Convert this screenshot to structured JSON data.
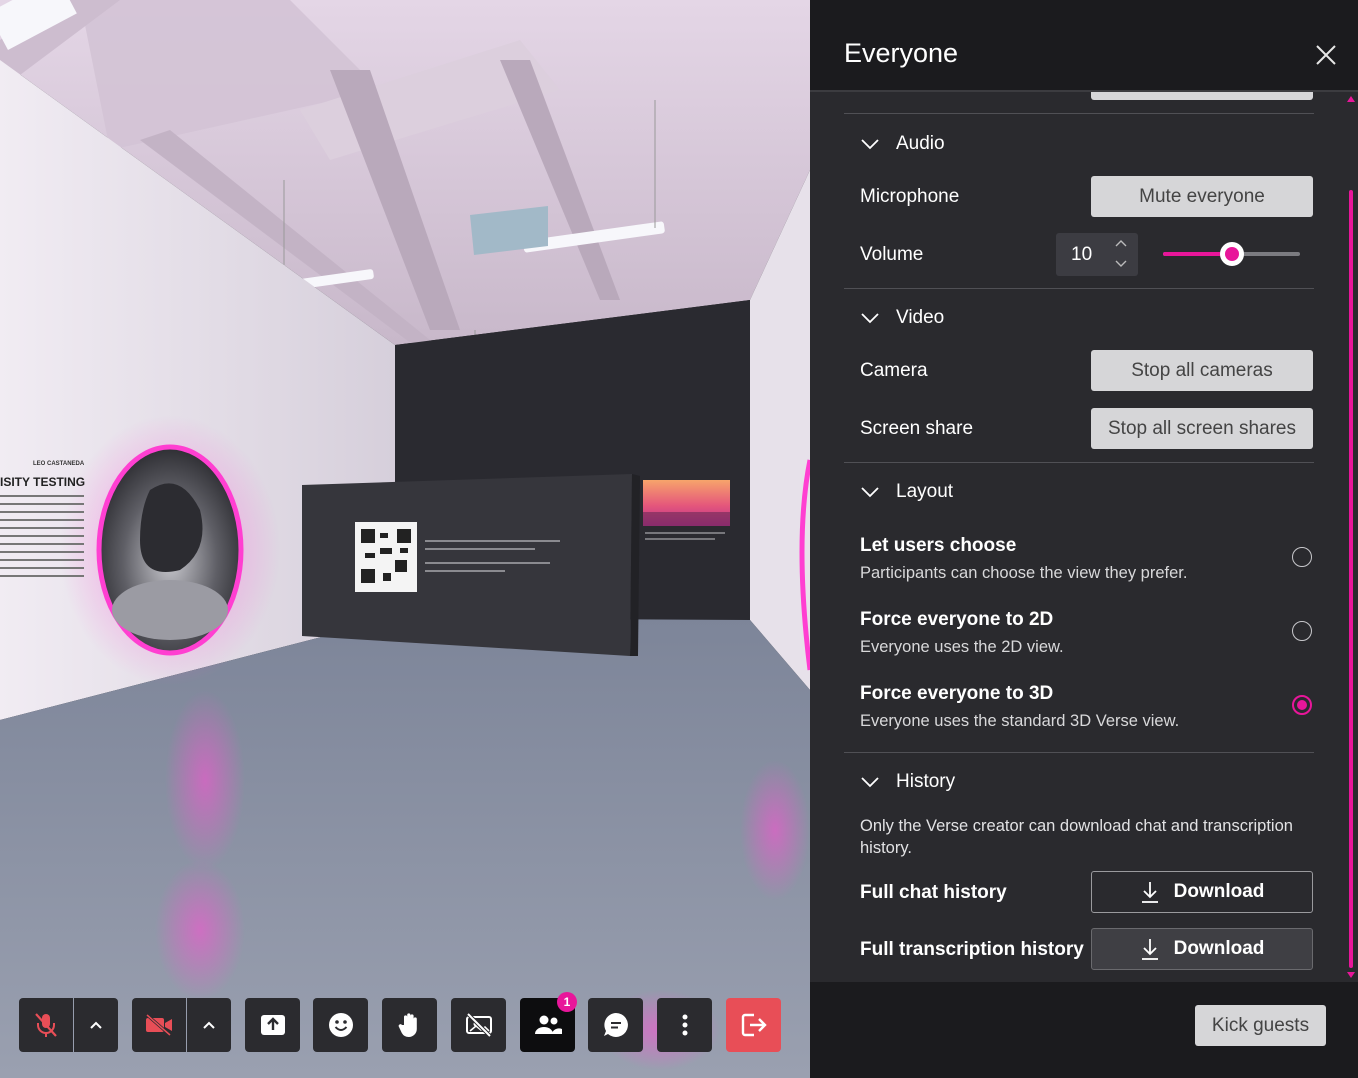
{
  "panel": {
    "title": "Everyone",
    "audio": {
      "heading": "Audio",
      "microphone_label": "Microphone",
      "mute_button": "Mute everyone",
      "volume_label": "Volume",
      "volume_value": "10",
      "volume_level_fraction": 0.5
    },
    "video": {
      "heading": "Video",
      "camera_label": "Camera",
      "camera_button": "Stop all cameras",
      "screen_label": "Screen share",
      "screen_button": "Stop all screen shares"
    },
    "layout": {
      "heading": "Layout",
      "options": [
        {
          "title": "Let users choose",
          "desc": "Participants can choose the view they prefer.",
          "selected": false
        },
        {
          "title": "Force everyone to 2D",
          "desc": "Everyone uses the 2D view.",
          "selected": false
        },
        {
          "title": "Force everyone to 3D",
          "desc": "Everyone uses the standard 3D Verse view.",
          "selected": true
        }
      ]
    },
    "history": {
      "heading": "History",
      "note": "Only the Verse creator can download chat and transcription history.",
      "chat_label": "Full chat history",
      "chat_button": "Download",
      "transcript_label": "Full transcription history",
      "transcript_button": "Download"
    },
    "kick_button": "Kick guests"
  },
  "toolbar": {
    "people_badge": "1"
  },
  "scene": {
    "wall_heading": "ISITY TESTING",
    "wall_byline": "LEO CASTANEDA"
  },
  "colors": {
    "accent": "#e8169a",
    "leave": "#e84e57"
  }
}
